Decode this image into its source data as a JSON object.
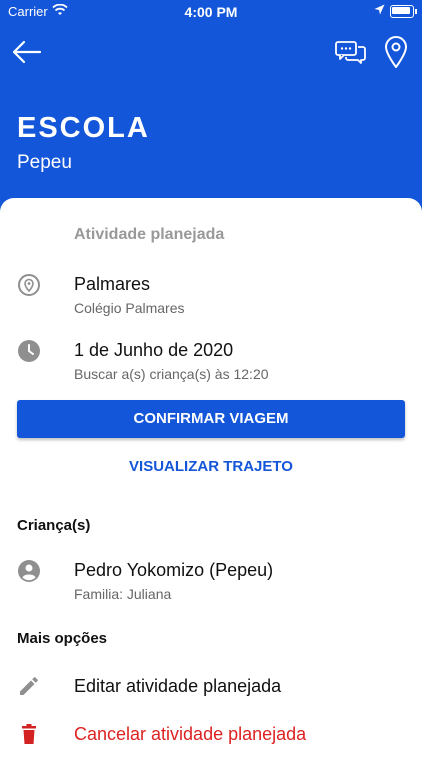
{
  "status_bar": {
    "carrier": "Carrier",
    "time": "4:00 PM"
  },
  "header": {
    "title": "ESCOLA",
    "subtitle": "Pepeu"
  },
  "activity": {
    "section_label": "Atividade planejada",
    "place_name": "Palmares",
    "place_detail": "Colégio Palmares",
    "date": "1 de Junho de 2020",
    "pickup": "Buscar a(s) criança(s) às 12:20"
  },
  "actions": {
    "confirm": "CONFIRMAR VIAGEM",
    "view_route": "VISUALIZAR TRAJETO"
  },
  "children": {
    "heading": "Criança(s)",
    "items": [
      {
        "name": "Pedro Yokomizo (Pepeu)",
        "family": "Familia: Juliana"
      }
    ]
  },
  "more_options": {
    "heading": "Mais opções",
    "edit": "Editar atividade planejada",
    "cancel": "Cancelar atividade planejada"
  },
  "colors": {
    "primary": "#1456d9",
    "danger": "#d22222",
    "icon_gray": "#8f8f8f"
  },
  "icons": [
    "back-arrow-icon",
    "chat-icon",
    "map-pin-icon",
    "location-pin-icon",
    "clock-icon",
    "person-icon",
    "pencil-icon",
    "trash-icon"
  ]
}
